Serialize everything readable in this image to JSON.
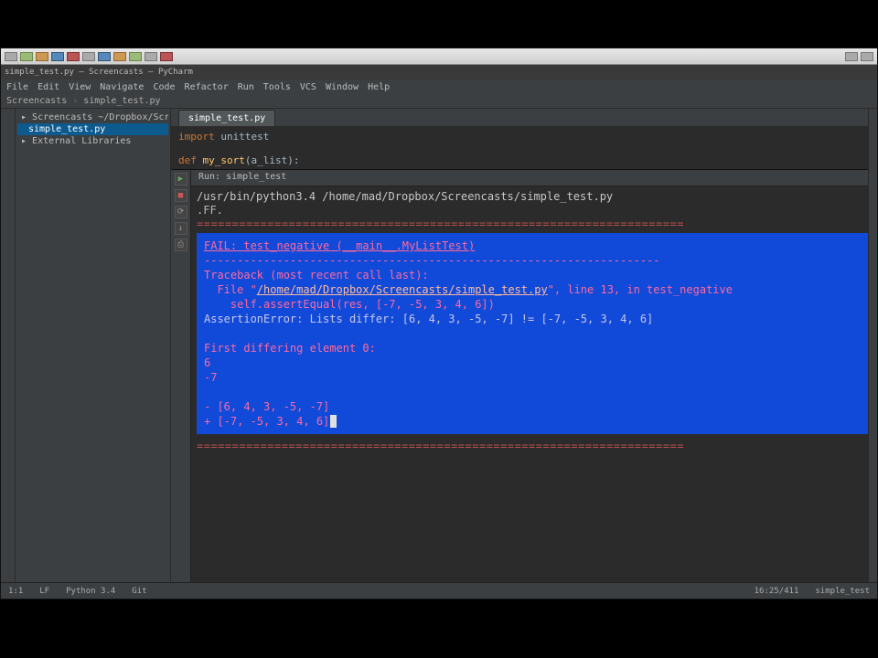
{
  "os_taskbar": {
    "items_count": 16
  },
  "ide": {
    "title": "simple_test.py — Screencasts — PyCharm",
    "menu": [
      "File",
      "Edit",
      "View",
      "Navigate",
      "Code",
      "Refactor",
      "Run",
      "Tools",
      "VCS",
      "Window",
      "Help"
    ],
    "crumb": {
      "folder": "Screencasts",
      "file": "simple_test.py"
    },
    "project": {
      "root": "Screencasts  ~/Dropbox/Screencasts",
      "file": "simple_test.py",
      "external": "External Libraries"
    },
    "tabs": {
      "active": "simple_test.py"
    },
    "code": {
      "l1_kw": "import",
      "l1_rest": " unittest",
      "l2_kw": "def",
      "l2_fn": " my_sort",
      "l2_rest": "(a_list):"
    },
    "tool": {
      "header": "Run: simple_test"
    },
    "terminal": {
      "cmd": "/usr/bin/python3.4 /home/mad/Dropbox/Screencasts/simple_test.py",
      "status": ".FF.",
      "divider": "=====================================================================",
      "fail_hdr": "FAIL: test_negative (__main__.MyListTest)",
      "dash": "---------------------------------------------------------------------",
      "tb1": "Traceback (most recent call last):",
      "tb2a": "  File \"",
      "tb2_path": "/home/mad/Dropbox/Screencasts/simple_test.py",
      "tb2b": "\", line 13, in test_negative",
      "tb3": "    self.assertEqual(res, [-7, -5, 3, 4, 6])",
      "tb4": "AssertionError: Lists differ: [6, 4, 3, -5, -7] != [-7, -5, 3, 4, 6]",
      "diff1": "First differing element 0:",
      "diff2": "6",
      "diff3": "-7",
      "diff4": "- [6, 4, 3, -5, -7]",
      "diff5": "+ [-7, -5, 3, 4, 6]",
      "divider2": "====================================================================="
    },
    "status": {
      "l1": "1:1",
      "l2": "LF",
      "l3": "Python 3.4",
      "l4": "Git",
      "r1": "16:25/411",
      "r2": "simple_test"
    }
  }
}
